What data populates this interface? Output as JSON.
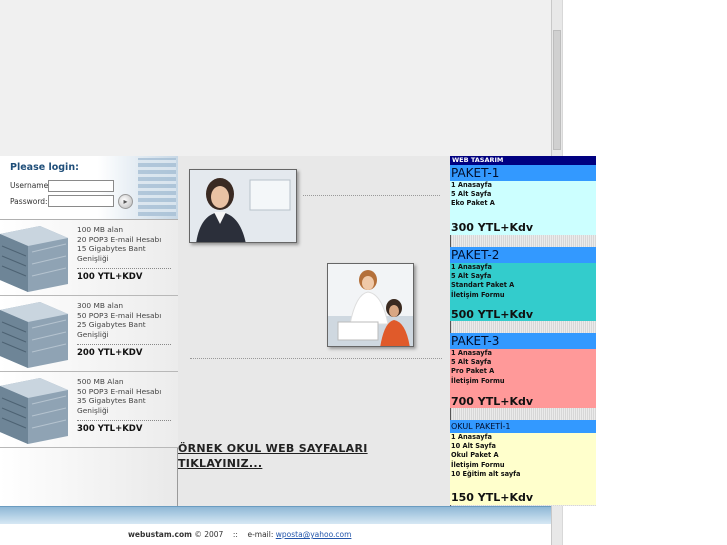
{
  "login": {
    "title": "Please login:",
    "username_label": "Username:",
    "password_label": "Password:"
  },
  "packages": [
    {
      "lines": [
        "100 MB alan",
        "20 POP3 E-mail Hesabı",
        "15 Gigabytes Bant Genişliği"
      ],
      "price": "100 YTL+KDV"
    },
    {
      "lines": [
        "300 MB alan",
        "50 POP3 E-mail Hesabı",
        "25 Gigabytes Bant Genişliği"
      ],
      "price": "200 YTL+KDV"
    },
    {
      "lines": [
        "500 MB Alan",
        "50 POP3 E-mail Hesabı",
        "35 Gigabytes Bant Genişliği"
      ],
      "price": "300 YTL+KDV"
    }
  ],
  "center": {
    "school_link": "ÖRNEK OKUL WEB SAYFALARI TIKLAYINIZ..."
  },
  "web_design": {
    "header": "WEB TASARIM",
    "packages": [
      {
        "title": "PAKET-1",
        "items": [
          "1 Anasayfa",
          "5 Alt Sayfa",
          "Eko Paket A"
        ],
        "price": "300 YTL+Kdv",
        "color": "#ccffff"
      },
      {
        "title": "PAKET-2",
        "items": [
          "1 Anasayfa",
          "5 Alt Sayfa",
          "Standart Paket A",
          "İletişim Formu"
        ],
        "price": "500 YTL+Kdv",
        "color": "#33cccc"
      },
      {
        "title": "PAKET-3",
        "items": [
          "1 Anasayfa",
          "5 Alt Sayfa",
          "Pro Paket A",
          "İletişim Formu"
        ],
        "price": "700 YTL+Kdv",
        "color": "#ff9999"
      },
      {
        "title": "OKUL PAKETİ-1",
        "items": [
          "1 Anasayfa",
          "10 Alt Sayfa",
          "Okul Paket A",
          "İletişim Formu",
          "10 Eğitim alt sayfa"
        ],
        "price": "150 YTL+Kdv",
        "color": "#ffffcc"
      }
    ],
    "title_bar_color": "#3399ff",
    "header_color": "#000080"
  },
  "footer": {
    "brand": "webustam.com",
    "year": "© 2007",
    "separator": "::",
    "email_label": "e-mail:",
    "email": "wposta@yahoo.com"
  }
}
